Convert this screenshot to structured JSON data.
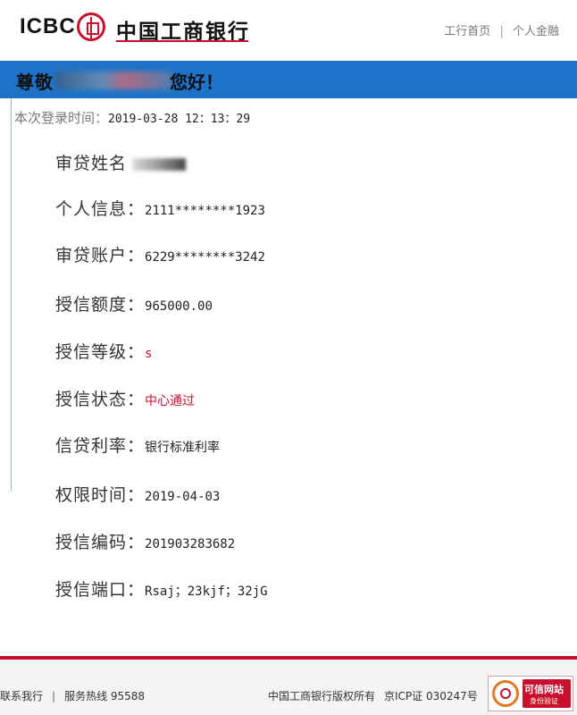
{
  "header": {
    "logo_text": "ICBC",
    "bank_name": "中国工商银行",
    "links": [
      "工行首页",
      "个人金融"
    ],
    "link_separator": "|"
  },
  "welcome": {
    "prefix": "尊敬",
    "suffix": "您好！"
  },
  "login": {
    "label": "本次登录时间：",
    "value": "2019-03-28  12：13：29"
  },
  "rows": [
    {
      "label": "审贷姓名",
      "value": ""
    },
    {
      "label": "个人信息：",
      "value": "2111********1923"
    },
    {
      "label": "审贷账户：",
      "value": "6229********3242"
    },
    {
      "label": "授信额度：",
      "value": "965000.00"
    },
    {
      "label": "授信等级：",
      "value": "s"
    },
    {
      "label": "授信状态：",
      "value": "中心通过"
    },
    {
      "label": "信贷利率：",
      "value": "银行标准利率"
    },
    {
      "label": "权限时间：",
      "value": "2019-04-03"
    },
    {
      "label": "授信编码：",
      "value": "201903283682"
    },
    {
      "label": "授信端口：",
      "value": "Rsaj；23kjf；32jG"
    }
  ],
  "footer": {
    "contact": "联系我行",
    "hotline": "服务热线 95588",
    "copyright": "中国工商银行版权所有",
    "icp": "京ICP证 030247号",
    "badge_title": "可信网站",
    "badge_sub": "身份验证"
  },
  "colors": {
    "brand_red": "#c8102e",
    "welcome_blue": "#1e73c8"
  }
}
